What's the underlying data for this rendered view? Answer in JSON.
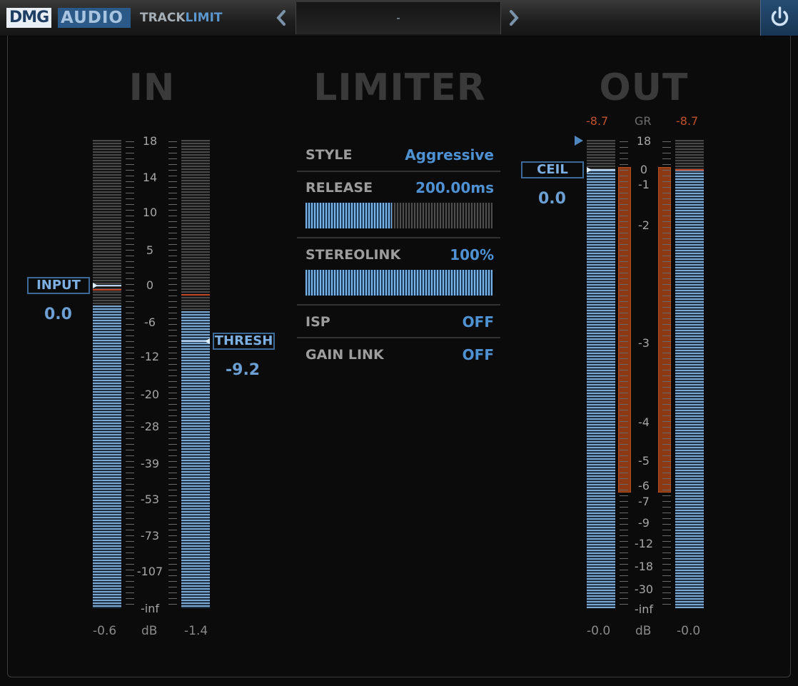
{
  "header": {
    "brand_part1": "DMG",
    "brand_part2": "AUDIO",
    "product_part1": "TRACK",
    "product_part2": "LIMIT",
    "preset_name": "-",
    "prev_icon": "chevron-left-icon",
    "next_icon": "chevron-right-icon",
    "power_icon": "power-icon"
  },
  "sections": {
    "in_title": "IN",
    "limiter_title": "LIMITER",
    "out_title": "OUT"
  },
  "in_scale": [
    "18",
    "14",
    "10",
    "5",
    "0",
    "-6",
    "-12",
    "-20",
    "-28",
    "-39",
    "-53",
    "-73",
    "-107",
    "-inf"
  ],
  "out_scale": [
    "18",
    "0",
    "-1",
    "-2",
    "-3",
    "-4",
    "-5",
    "-6",
    "-7",
    "-9",
    "-12",
    "-18",
    "-30",
    "-inf"
  ],
  "input": {
    "label": "INPUT",
    "value": "0.0",
    "left_peak": "-0.6",
    "right_peak": "-1.4",
    "unit": "dB"
  },
  "thresh": {
    "label": "THRESH",
    "value": "-9.2"
  },
  "limiter": {
    "style_label": "STYLE",
    "style_value": "Aggressive",
    "release_label": "RELEASE",
    "release_value": "200.00",
    "release_unit": "ms",
    "release_fraction": 0.46,
    "stereolink_label": "STEREOLINK",
    "stereolink_value": "100%",
    "stereolink_fraction": 1.0,
    "isp_label": "ISP",
    "isp_value": "OFF",
    "gainlink_label": "GAIN LINK",
    "gainlink_value": "OFF"
  },
  "output": {
    "ceil_label": "CEIL",
    "ceil_value": "0.0",
    "gr_label": "GR",
    "gr_left": "-8.7",
    "gr_right": "-8.7",
    "left_peak": "-0.0",
    "right_peak": "-0.0",
    "unit": "dB"
  },
  "colors": {
    "accent": "#4f92d3",
    "meter_fill": "#7aa6d2",
    "gain_reduction": "#8d3a14",
    "peak": "#c24626"
  }
}
